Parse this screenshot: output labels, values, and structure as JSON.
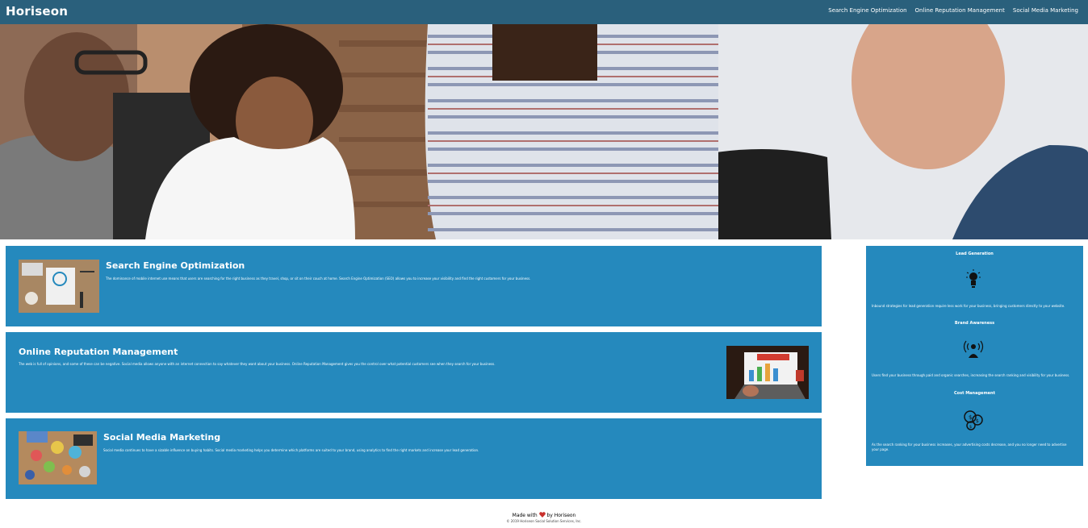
{
  "brand": {
    "name": "Horiseon"
  },
  "nav": {
    "items": [
      {
        "label": "Search Engine Optimization"
      },
      {
        "label": "Online Reputation Management"
      },
      {
        "label": "Social Media Marketing"
      }
    ]
  },
  "hero": {
    "image_icon": "hero-photo"
  },
  "content": {
    "sections": [
      {
        "title": "Search Engine Optimization",
        "text": "The dominance of mobile internet use means that users are searching for the right business as they travel, shop, or sit on their couch at home. Search Engine Optimization (SEO) allows you to increase your visibility and find the right customers for your business.",
        "image_icon": "seo-image"
      },
      {
        "title": "Online Reputation Management",
        "text": "The web is full of opinions, and some of these can be negative. Social media allows anyone with an internet connection to say whatever they want about your business. Online Reputation Management gives you the control over what potential customers see when they search for your business.",
        "image_icon": "reputation-image"
      },
      {
        "title": "Social Media Marketing",
        "text": "Social media continues to have a sizable influence on buying habits. Social media marketing helps you determine which platforms are suited to your brand, using analytics to find the right markets and increase your lead generation.",
        "image_icon": "social-media-image"
      }
    ]
  },
  "benefits": {
    "items": [
      {
        "title": "Lead Generation",
        "text": "Inbound strategies for lead generation require less work for your business, bringing customers directly to your website.",
        "icon": "lightbulb-icon"
      },
      {
        "title": "Brand Awareness",
        "text": "Users find your business through paid and organic searches, increasing the search ranking and visibility for your business.",
        "icon": "broadcast-person-icon"
      },
      {
        "title": "Cost Management",
        "text": "As the search ranking for your business increases, your advertising costs decrease, and you no longer need to advertise your page.",
        "icon": "money-gears-icon"
      }
    ]
  },
  "footer": {
    "made_prefix": "Made with",
    "made_suffix": "by Horiseon",
    "copyright": "© 2019 Horiseon Social Solution Services, Inc."
  },
  "colors": {
    "header": "#2a607c",
    "card": "#2589bd",
    "heart": "#c9302c"
  }
}
